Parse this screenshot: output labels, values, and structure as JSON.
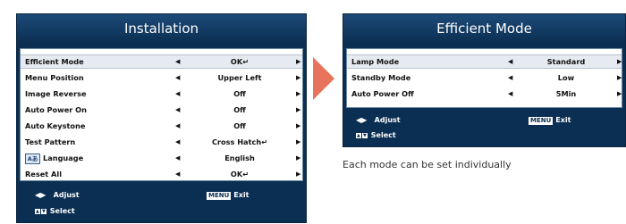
{
  "colors": {
    "frame": "#0b2f52",
    "selected_row": "#e6ebf1",
    "pointer": "#e7735a",
    "panel": "#ffffff"
  },
  "left_menu": {
    "title": "Installation",
    "items": [
      {
        "label": "Efficient Mode",
        "value": "OK",
        "value_icon": "enter-icon"
      },
      {
        "label": "Menu Position",
        "value": "Upper Left"
      },
      {
        "label": "Image Reverse",
        "value": "Off"
      },
      {
        "label": "Auto Power On",
        "value": "Off"
      },
      {
        "label": "Auto Keystone",
        "value": "Off"
      },
      {
        "label": "Test Pattern",
        "value": "Cross Hatch",
        "value_icon": "enter-icon"
      },
      {
        "label": "Language",
        "value": "English",
        "label_icon": "language-icon"
      },
      {
        "label": "Reset All",
        "value": "OK",
        "value_icon": "enter-icon"
      }
    ],
    "footer": {
      "adjust": "Adjust",
      "exit_badge": "MENU",
      "exit": "Exit",
      "select": "Select"
    }
  },
  "right_menu": {
    "title": "Efficient Mode",
    "items": [
      {
        "label": "Lamp Mode",
        "value": "Standard"
      },
      {
        "label": "Standby Mode",
        "value": "Low"
      },
      {
        "label": "Auto Power Off",
        "value": "5Min"
      }
    ],
    "footer": {
      "adjust": "Adjust",
      "exit_badge": "MENU",
      "exit": "Exit",
      "select": "Select"
    }
  },
  "caption": "Each mode can be set individually",
  "lang_icon_text": "Aあ"
}
